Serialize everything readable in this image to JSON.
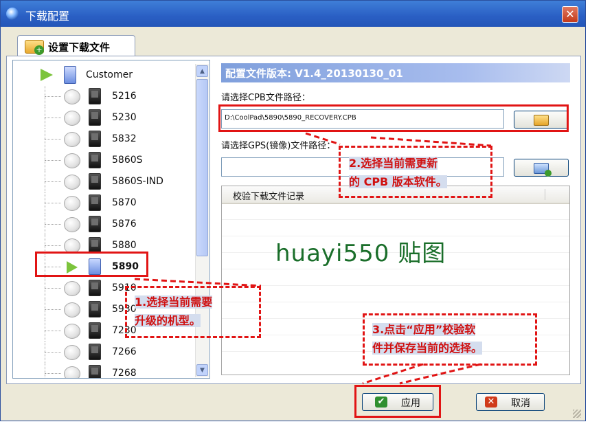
{
  "window": {
    "title": "下载配置",
    "close_label": "✕"
  },
  "tabs": [
    {
      "label": "设置下载文件"
    }
  ],
  "tree": {
    "root": "Customer",
    "models": [
      "5216",
      "5230",
      "5832",
      "5860S",
      "5860S-IND",
      "5870",
      "5876",
      "5880",
      "5890",
      "5910",
      "5930",
      "7230",
      "7266",
      "7268"
    ],
    "selected": "5890"
  },
  "config": {
    "version_label": "配置文件版本: V1.4_20130130_01",
    "cpb_label": "请选择CPB文件路径：",
    "cpb_path": "D:\\CoolPad\\5890\\5890_RECOVERY.CPB",
    "gps_label": "请选择GPS(镜像)文件路径：",
    "gps_path": "",
    "log_header": "校验下载文件记录"
  },
  "watermark": "huayi550 贴图",
  "buttons": {
    "apply": "应用",
    "cancel": "取消"
  },
  "annotations": {
    "note1_line1": "1.选择当前需要",
    "note1_line2": "升级的机型。",
    "note2_line1": "2.选择当前需更新",
    "note2_line2": "的 CPB 版本软件。",
    "note3_line1": "3.点击“应用”校验软",
    "note3_line2": "件并保存当前的选择。"
  },
  "colors": {
    "annotation_red": "#e11414",
    "title_blue": "#2a5fc4",
    "watermark_green": "#1a6e2a"
  }
}
